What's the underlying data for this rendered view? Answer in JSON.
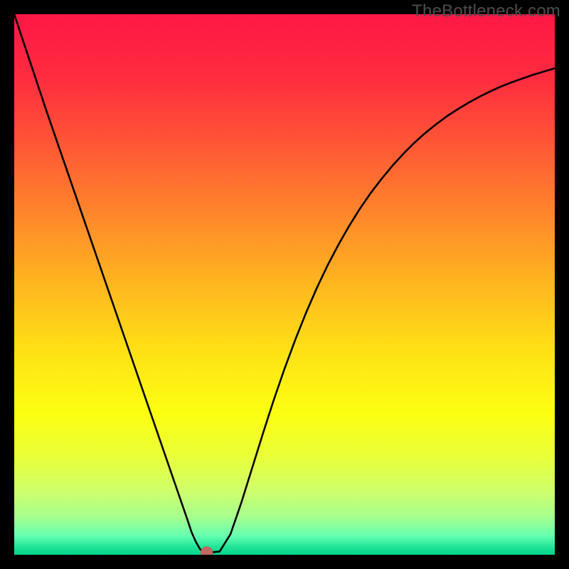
{
  "watermark": "TheBottleneck.com",
  "chart_data": {
    "type": "line",
    "title": "",
    "xlabel": "",
    "ylabel": "",
    "xlim": [
      0,
      1000
    ],
    "ylim": [
      0,
      1000
    ],
    "grid": false,
    "background_gradient": {
      "stops": [
        {
          "offset": 0.0,
          "color": "#ff1745"
        },
        {
          "offset": 0.12,
          "color": "#ff2c3f"
        },
        {
          "offset": 0.25,
          "color": "#ff5a35"
        },
        {
          "offset": 0.38,
          "color": "#ff8a2a"
        },
        {
          "offset": 0.5,
          "color": "#ffb61f"
        },
        {
          "offset": 0.62,
          "color": "#ffe015"
        },
        {
          "offset": 0.74,
          "color": "#fcff12"
        },
        {
          "offset": 0.82,
          "color": "#e8ff3a"
        },
        {
          "offset": 0.88,
          "color": "#d0ff6a"
        },
        {
          "offset": 0.93,
          "color": "#a6ff8e"
        },
        {
          "offset": 0.965,
          "color": "#66ffb0"
        },
        {
          "offset": 0.985,
          "color": "#22e59a"
        },
        {
          "offset": 1.0,
          "color": "#00d38a"
        }
      ]
    },
    "series": [
      {
        "name": "curve",
        "color": "#000000",
        "x": [
          0,
          20,
          40,
          60,
          80,
          100,
          120,
          140,
          160,
          180,
          200,
          220,
          240,
          260,
          280,
          300,
          310,
          320,
          328,
          336,
          344,
          352,
          360,
          380,
          400,
          420,
          440,
          460,
          480,
          500,
          520,
          540,
          560,
          580,
          600,
          620,
          640,
          660,
          680,
          700,
          720,
          740,
          760,
          780,
          800,
          820,
          840,
          860,
          880,
          900,
          920,
          940,
          960,
          980,
          1000
        ],
        "y": [
          1000,
          940,
          880,
          820,
          762,
          704,
          646,
          588,
          530,
          472,
          414,
          356,
          298,
          240,
          182,
          124,
          95,
          66,
          42,
          24,
          10,
          4,
          4,
          6,
          38,
          96,
          160,
          224,
          286,
          344,
          398,
          448,
          494,
          536,
          574,
          609,
          641,
          670,
          696,
          720,
          742,
          762,
          780,
          796,
          811,
          824,
          836,
          847,
          857,
          866,
          874,
          881,
          888,
          894,
          900
        ]
      }
    ],
    "marker": {
      "x": 356,
      "y": 4,
      "r": 11,
      "fill": "#c26a63",
      "stroke": "#b95c55"
    },
    "annotations": []
  }
}
